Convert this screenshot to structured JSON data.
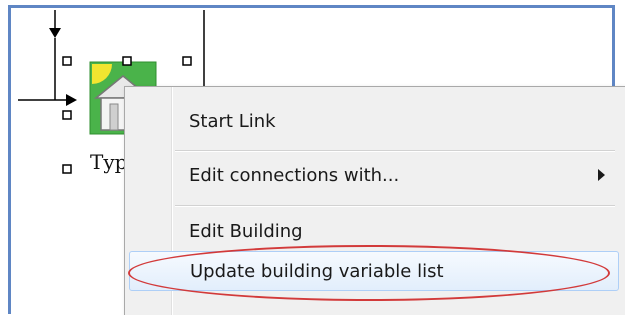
{
  "diagram": {
    "node_label": "Typ"
  },
  "context_menu": {
    "items": [
      {
        "label": "Start Link",
        "has_submenu": false,
        "highlighted": false
      },
      {
        "label": "Edit connections with...",
        "has_submenu": true,
        "highlighted": false
      },
      {
        "label": "Edit Building",
        "has_submenu": false,
        "highlighted": false
      },
      {
        "label": "Update building variable list",
        "has_submenu": false,
        "highlighted": true
      }
    ]
  },
  "annotation": {
    "shape": "ellipse",
    "color": "#d23a3a"
  },
  "icons": {
    "node": "building-icon",
    "submenu": "submenu-arrow-icon"
  }
}
